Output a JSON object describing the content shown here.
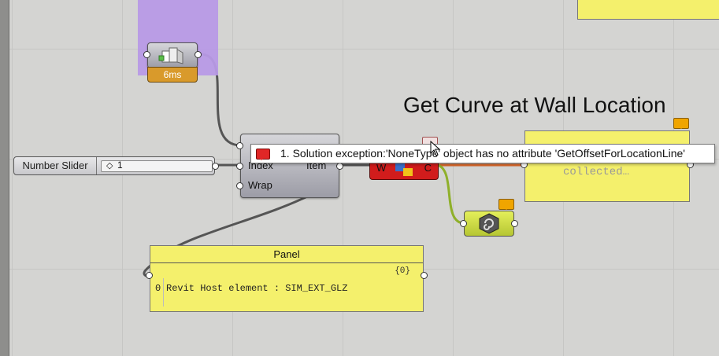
{
  "canvas": {
    "title": "Get Curve at Wall Location"
  },
  "timer_component": {
    "time_label": "6ms",
    "icon": "wall-geometry-icon"
  },
  "slider": {
    "label": "Number Slider",
    "value": "1"
  },
  "list_item": {
    "inputs": [
      "Index",
      "Wrap"
    ],
    "output": "Item"
  },
  "error_tooltip": {
    "message": "1. Solution exception:'NoneType' object has no attribute 'GetOffsetForLocationLine'"
  },
  "yellow_panel": {
    "text": "collected…"
  },
  "panel": {
    "title": "Panel",
    "path": "{0}",
    "rows": [
      {
        "index": "0",
        "value": "Revit Host element : SIM_EXT_GLZ"
      }
    ]
  },
  "colors": {
    "canvas": "#d4d4d2",
    "group": "#b89ae6",
    "error": "#d11c1c",
    "panel": "#f4f06c",
    "warning": "#f0a500",
    "timer": "#d99a2b"
  },
  "icons": [
    "wall-geometry-icon",
    "error-balloon-icon",
    "warning-balloon-icon",
    "spiral-hex-icon",
    "mouse-cursor-icon"
  ]
}
